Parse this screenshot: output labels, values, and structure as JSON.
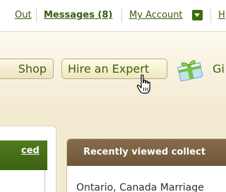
{
  "top_links": {
    "sign_out": "Out",
    "messages": "Messages (8)",
    "my_account": "My Account",
    "help": "H"
  },
  "nav": {
    "shop": "Shop",
    "hire_an_expert": "Hire an Expert",
    "gift": "Gi"
  },
  "left_panel": {
    "tab_label": "ced"
  },
  "recently_viewed": {
    "title": "Recently viewed collect",
    "first_item": "Ontario, Canada Marriage"
  },
  "colors": {
    "link_green": "#3a5a10",
    "header_brown": "#7a6243",
    "panel_green": "#46701a",
    "background_tan": "#f3ead2"
  }
}
